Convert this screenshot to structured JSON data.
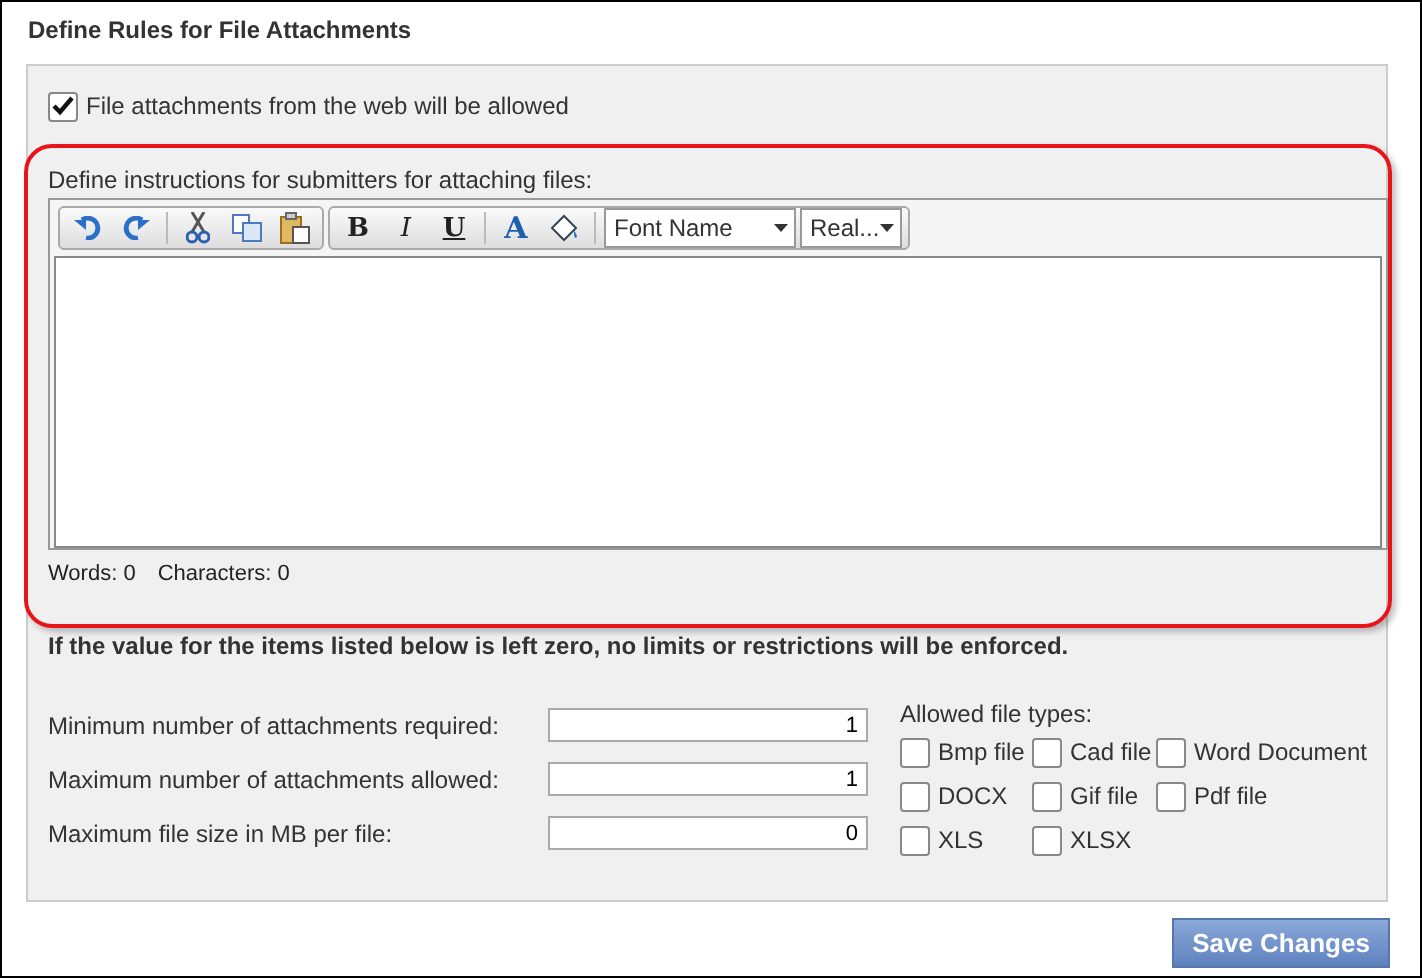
{
  "section_title": "Define Rules for File Attachments",
  "allow_web": {
    "label": "File attachments from the web will be allowed",
    "checked": true
  },
  "editor": {
    "label": "Define instructions for submitters for attaching files:",
    "toolbar": [
      {
        "kind": "undo"
      },
      {
        "kind": "redo"
      },
      {
        "kind": "sep"
      },
      {
        "kind": "cut"
      },
      {
        "kind": "copy"
      },
      {
        "kind": "paste"
      },
      {
        "kind": "group"
      },
      {
        "kind": "bold",
        "text": "B"
      },
      {
        "kind": "italic",
        "text": "I"
      },
      {
        "kind": "underline",
        "text": "U"
      },
      {
        "kind": "sep"
      },
      {
        "kind": "color",
        "text": "A"
      },
      {
        "kind": "fill"
      },
      {
        "kind": "sep"
      }
    ],
    "font_name": "Font Name",
    "font_size": "Real...",
    "words": "Words: 0",
    "characters": "Characters: 0"
  },
  "notice": "If the value for the items listed below is left zero, no limits or restrictions will be enforced.",
  "limits": [
    {
      "label": "Minimum number of attachments required:",
      "value": "1"
    },
    {
      "label": "Maximum number of attachments allowed:",
      "value": "1"
    },
    {
      "label": "Maximum file size in MB per file:",
      "value": "0"
    }
  ],
  "file_types": {
    "label": "Allowed file types:",
    "items": [
      {
        "label": "Bmp file",
        "checked": false
      },
      {
        "label": "Cad file",
        "checked": false
      },
      {
        "label": "Word Document",
        "checked": false
      },
      {
        "label": "DOCX",
        "checked": false
      },
      {
        "label": "Gif file",
        "checked": false
      },
      {
        "label": "Pdf file",
        "checked": false
      },
      {
        "label": "XLS",
        "checked": false
      },
      {
        "label": "XLSX",
        "checked": false
      }
    ]
  },
  "save_button": "Save Changes"
}
